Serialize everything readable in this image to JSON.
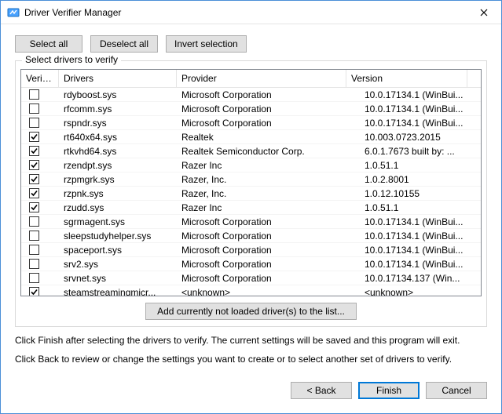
{
  "window": {
    "title": "Driver Verifier Manager"
  },
  "toolbar": {
    "select_all": "Select all",
    "deselect_all": "Deselect all",
    "invert_selection": "Invert selection"
  },
  "group": {
    "legend": "Select drivers to verify",
    "columns": {
      "verify": "Verify?",
      "drivers": "Drivers",
      "provider": "Provider",
      "version": "Version"
    },
    "rows": [
      {
        "checked": false,
        "driver": "rdyboost.sys",
        "provider": "Microsoft Corporation",
        "version": "10.0.17134.1 (WinBui..."
      },
      {
        "checked": false,
        "driver": "rfcomm.sys",
        "provider": "Microsoft Corporation",
        "version": "10.0.17134.1 (WinBui..."
      },
      {
        "checked": false,
        "driver": "rspndr.sys",
        "provider": "Microsoft Corporation",
        "version": "10.0.17134.1 (WinBui..."
      },
      {
        "checked": true,
        "driver": "rt640x64.sys",
        "provider": "Realtek",
        "version": "10.003.0723.2015"
      },
      {
        "checked": true,
        "driver": "rtkvhd64.sys",
        "provider": "Realtek Semiconductor Corp.",
        "version": "6.0.1.7673 built by: ..."
      },
      {
        "checked": true,
        "driver": "rzendpt.sys",
        "provider": "Razer Inc",
        "version": "1.0.51.1"
      },
      {
        "checked": true,
        "driver": "rzpmgrk.sys",
        "provider": "Razer, Inc.",
        "version": "1.0.2.8001"
      },
      {
        "checked": true,
        "driver": "rzpnk.sys",
        "provider": "Razer, Inc.",
        "version": "1.0.12.10155"
      },
      {
        "checked": true,
        "driver": "rzudd.sys",
        "provider": "Razer Inc",
        "version": "1.0.51.1"
      },
      {
        "checked": false,
        "driver": "sgrmagent.sys",
        "provider": "Microsoft Corporation",
        "version": "10.0.17134.1 (WinBui..."
      },
      {
        "checked": false,
        "driver": "sleepstudyhelper.sys",
        "provider": "Microsoft Corporation",
        "version": "10.0.17134.1 (WinBui..."
      },
      {
        "checked": false,
        "driver": "spaceport.sys",
        "provider": "Microsoft Corporation",
        "version": "10.0.17134.1 (WinBui..."
      },
      {
        "checked": false,
        "driver": "srv2.sys",
        "provider": "Microsoft Corporation",
        "version": "10.0.17134.1 (WinBui..."
      },
      {
        "checked": false,
        "driver": "srvnet.sys",
        "provider": "Microsoft Corporation",
        "version": "10.0.17134.137 (Win..."
      },
      {
        "checked": true,
        "driver": "steamstreamingmicr...",
        "provider": "<unknown>",
        "version": "<unknown>"
      }
    ],
    "add_button": "Add currently not loaded driver(s) to the list..."
  },
  "help": {
    "line1": "Click Finish after selecting the drivers to verify. The current settings will be saved and this program will exit.",
    "line2": "Click Back to review or change the settings you want to create or to select another set of drivers to verify."
  },
  "footer": {
    "back": "< Back",
    "finish": "Finish",
    "cancel": "Cancel"
  }
}
